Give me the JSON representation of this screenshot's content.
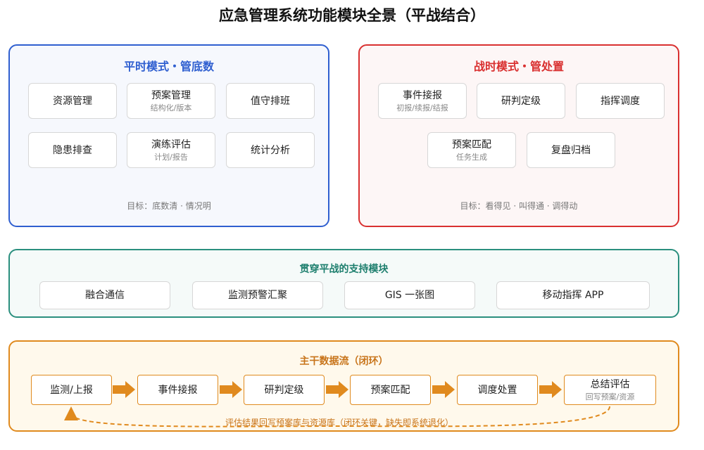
{
  "title": "应急管理系统功能模块全景（平战结合）",
  "peacetime": {
    "title": "平时模式・管底数",
    "modules": [
      {
        "name": "资源管理",
        "sub": ""
      },
      {
        "name": "预案管理",
        "sub": "结构化/版本"
      },
      {
        "name": "值守排班",
        "sub": ""
      },
      {
        "name": "隐患排查",
        "sub": ""
      },
      {
        "name": "演练评估",
        "sub": "计划/报告"
      },
      {
        "name": "统计分析",
        "sub": ""
      }
    ],
    "goal": "目标：底数清 · 情况明"
  },
  "wartime": {
    "title": "战时模式・管处置",
    "modules": [
      {
        "name": "事件接报",
        "sub": "初报/续报/结报"
      },
      {
        "name": "研判定级",
        "sub": ""
      },
      {
        "name": "指挥调度",
        "sub": ""
      },
      {
        "name": "预案匹配",
        "sub": "任务生成"
      },
      {
        "name": "复盘归档",
        "sub": ""
      }
    ],
    "goal": "目标：看得见 · 叫得通 · 调得动"
  },
  "support": {
    "title": "贯穿平战的支持模块",
    "modules": [
      "融合通信",
      "监测预警汇聚",
      "GIS 一张图",
      "移动指挥 APP"
    ]
  },
  "flow": {
    "title": "主干数据流（闭环）",
    "steps": [
      {
        "name": "监测/上报",
        "sub": ""
      },
      {
        "name": "事件接报",
        "sub": ""
      },
      {
        "name": "研判定级",
        "sub": ""
      },
      {
        "name": "预案匹配",
        "sub": ""
      },
      {
        "name": "调度处置",
        "sub": ""
      },
      {
        "name": "总结评估",
        "sub": "回写预案/资源"
      }
    ],
    "loop_text": "评估结果回写预案库与资源库（闭环关键，缺失即系统退化）"
  },
  "colors": {
    "blue": "#2f5fd0",
    "red": "#d93030",
    "green": "#2a8f7e",
    "orange": "#e08a1e"
  }
}
